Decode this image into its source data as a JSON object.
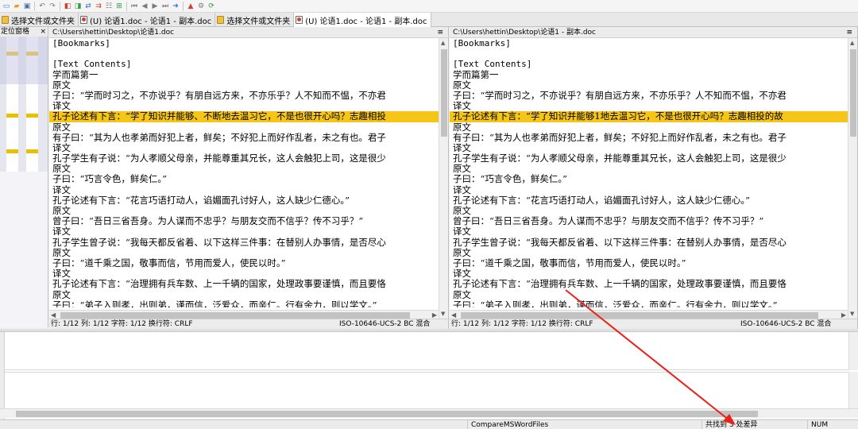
{
  "toolbar": {
    "icons": [
      "new-file-icon",
      "open-folder-icon",
      "save-icon",
      "undo-icon",
      "redo-icon",
      "copy-left-icon",
      "copy-right-icon",
      "compare-icon",
      "merge-icon",
      "tree-icon",
      "expand-icon",
      "first-diff-icon",
      "prev-diff-icon",
      "next-diff-icon",
      "last-diff-icon",
      "goto-icon",
      "bookmark-icon",
      "options-icon",
      "refresh-icon"
    ]
  },
  "tabs": [
    {
      "label": "选择文件或文件夹",
      "type": "folder",
      "active": false
    },
    {
      "label": "(U) 论语1.doc - 论语1 - 副本.doc",
      "type": "doc",
      "active": false
    },
    {
      "label": "选择文件或文件夹",
      "type": "folder",
      "active": false
    },
    {
      "label": "(U) 论语1.doc - 论语1 - 副本.doc",
      "type": "doc",
      "active": true
    }
  ],
  "location_pane": {
    "title": "定位窗格",
    "close": "×"
  },
  "left_pane": {
    "path": "C:\\Users\\hettin\\Desktop\\论语1.doc",
    "menu_glyph": "≡",
    "lines": [
      {
        "text": "[Bookmarks]",
        "mono": true,
        "diff": false
      },
      {
        "text": "",
        "mono": true,
        "diff": false
      },
      {
        "text": "[Text Contents]",
        "mono": true,
        "diff": false
      },
      {
        "text": "学而篇第一",
        "mono": false,
        "diff": false
      },
      {
        "text": "原文",
        "mono": false,
        "diff": false
      },
      {
        "text": "子曰：“学而时习之，不亦说乎？有朋自远方来，不亦乐乎？人不知而不愠，不亦君",
        "mono": false,
        "diff": false
      },
      {
        "text": "译文",
        "mono": false,
        "diff": false
      },
      {
        "text": "孔子论述有下言：“学了知识并能够、不断地去温习它，不是也很开心吗？志趣相投",
        "mono": false,
        "diff": true
      },
      {
        "text": "原文",
        "mono": false,
        "diff": false
      },
      {
        "text": "有子曰：“其为人也孝弟而好犯上者，鲜矣；不好犯上而好作乱者，未之有也。君子",
        "mono": false,
        "diff": false
      },
      {
        "text": "译文",
        "mono": false,
        "diff": false
      },
      {
        "text": "孔子学生有子说：“为人孝顺父母亲，并能尊重其兄长，这人会触犯上司，这是很少",
        "mono": false,
        "diff": false
      },
      {
        "text": "原文",
        "mono": false,
        "diff": false
      },
      {
        "text": "子曰：“巧言令色，鲜矣仁。”",
        "mono": false,
        "diff": false
      },
      {
        "text": "译文",
        "mono": false,
        "diff": false
      },
      {
        "text": "孔子论述有下言：“花言巧语打动人，谄媚面孔讨好人，这人缺少仁德心。”",
        "mono": false,
        "diff": false
      },
      {
        "text": "原文",
        "mono": false,
        "diff": false
      },
      {
        "text": "曾子曰：“吾日三省吾身。为人谋而不忠乎？与朋友交而不信乎？传不习乎？”",
        "mono": false,
        "diff": false
      },
      {
        "text": "译文",
        "mono": false,
        "diff": false
      },
      {
        "text": "孔子学生曾子说：“我每天都反省着、以下这样三件事：在替别人办事情，是否尽心",
        "mono": false,
        "diff": false
      },
      {
        "text": "原文",
        "mono": false,
        "diff": false
      },
      {
        "text": "子曰：“道千乘之国，敬事而信，节用而爱人，使民以时。”",
        "mono": false,
        "diff": false
      },
      {
        "text": "译文",
        "mono": false,
        "diff": false
      },
      {
        "text": "孔子论述有下言：“治理拥有兵车数、上一千辆的国家，处理政事要谨慎，而且要恪",
        "mono": false,
        "diff": false
      },
      {
        "text": "原文",
        "mono": false,
        "diff": false
      },
      {
        "text": "子曰：“弟子入则孝，出则弟，谨而信，泛爱众，而亲仁。行有余力，则以学文。”",
        "mono": false,
        "diff": false
      }
    ],
    "status": "行: 1/12  列: 1/12  字符: 1/12  换行符: CRLF",
    "encoding": "ISO-10646-UCS-2 BC 混合"
  },
  "right_pane": {
    "path": "C:\\Users\\hettin\\Desktop\\论语1 - 副本.doc",
    "menu_glyph": "≡",
    "lines": [
      {
        "text": "[Bookmarks]",
        "mono": true,
        "diff": false
      },
      {
        "text": "",
        "mono": true,
        "diff": false
      },
      {
        "text": "[Text Contents]",
        "mono": true,
        "diff": false
      },
      {
        "text": "学而篇第一",
        "mono": false,
        "diff": false
      },
      {
        "text": "原文",
        "mono": false,
        "diff": false
      },
      {
        "text": "子曰：“学而时习之，不亦说乎？有朋自远方来，不亦乐乎？人不知而不愠，不亦君",
        "mono": false,
        "diff": false
      },
      {
        "text": "译文",
        "mono": false,
        "diff": false
      },
      {
        "text": "孔子论述有下言：“学了知识并能够1地去温习它，不是也很开心吗？志趣相投的故",
        "mono": false,
        "diff": true
      },
      {
        "text": "原文",
        "mono": false,
        "diff": false
      },
      {
        "text": "有子曰：“其为人也孝弟而好犯上者，鲜矣；不好犯上而好作乱者，未之有也。君子",
        "mono": false,
        "diff": false
      },
      {
        "text": "译文",
        "mono": false,
        "diff": false
      },
      {
        "text": "孔子学生有子说：“为人孝顺父母亲，并能尊重其兄长，这人会触犯上司，这是很少",
        "mono": false,
        "diff": false
      },
      {
        "text": "原文",
        "mono": false,
        "diff": false
      },
      {
        "text": "子曰：“巧言令色，鲜矣仁。”",
        "mono": false,
        "diff": false
      },
      {
        "text": "译文",
        "mono": false,
        "diff": false
      },
      {
        "text": "孔子论述有下言：“花言巧语打动人，谄媚面孔讨好人，这人缺少仁德心。”",
        "mono": false,
        "diff": false
      },
      {
        "text": "原文",
        "mono": false,
        "diff": false
      },
      {
        "text": "曾子曰：“吾日三省吾身。为人谋而不忠乎？与朋友交而不信乎？传不习乎？”",
        "mono": false,
        "diff": false
      },
      {
        "text": "译文",
        "mono": false,
        "diff": false
      },
      {
        "text": "孔子学生曾子说：“我每天都反省着、以下这样三件事：在替别人办事情，是否尽心",
        "mono": false,
        "diff": false
      },
      {
        "text": "原文",
        "mono": false,
        "diff": false
      },
      {
        "text": "子曰：“道千乘之国，敬事而信，节用而爱人，使民以时。”",
        "mono": false,
        "diff": false
      },
      {
        "text": "译文",
        "mono": false,
        "diff": false
      },
      {
        "text": "孔子论述有下言：“治理拥有兵车数、上一千辆的国家，处理政事要谨慎，而且要恪",
        "mono": false,
        "diff": false
      },
      {
        "text": "原文",
        "mono": false,
        "diff": false
      },
      {
        "text": "子曰：“弟子入则孝，出则弟，谨而信，泛爱众，而亲仁。行有余力，则以学文。”",
        "mono": false,
        "diff": false
      }
    ],
    "status": "行: 1/12  列: 1/12  字符: 1/12  换行符: CRLF",
    "encoding": "ISO-10646-UCS-2 BC 混合"
  },
  "statusbar": {
    "plugin": "CompareMSWordFiles",
    "diff_count": "共找到 3 处差异",
    "num": "NUM"
  },
  "colors": {
    "diff_line": "#f5c518",
    "arrow": "#e8231a"
  }
}
